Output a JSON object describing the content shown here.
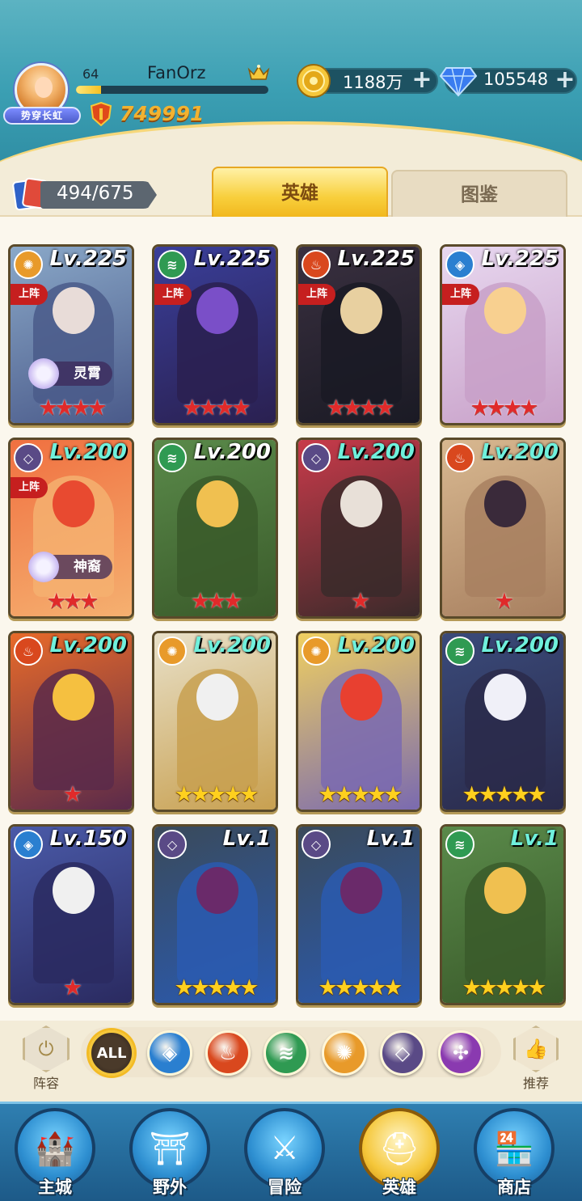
{
  "player": {
    "level": "64",
    "name": "FanOrz",
    "title_badge": "势穿长虹",
    "power": "749991",
    "exp_fraction": 0.13
  },
  "resources": {
    "gold": "1188万",
    "gems": "105548"
  },
  "collection": {
    "card_count": "494/675"
  },
  "tabs": [
    {
      "label": "英雄",
      "active": true
    },
    {
      "label": "图鉴",
      "active": false
    }
  ],
  "heroes": [
    {
      "level": "Lv.225",
      "faction": "light",
      "deployed": "上阵",
      "badge": "灵霄",
      "stars": 4,
      "star_color": "red"
    },
    {
      "level": "Lv.225",
      "faction": "nature",
      "deployed": "上阵",
      "badge": "",
      "stars": 4,
      "star_color": "red"
    },
    {
      "level": "Lv.225",
      "faction": "fire",
      "deployed": "上阵",
      "badge": "",
      "stars": 4,
      "star_color": "red"
    },
    {
      "level": "Lv.225",
      "faction": "water",
      "deployed": "上阵",
      "badge": "",
      "stars": 4,
      "star_color": "red"
    },
    {
      "level": "Lv.200",
      "faction": "dark",
      "deployed": "上阵",
      "badge": "神裔",
      "stars": 3,
      "star_color": "red"
    },
    {
      "level": "Lv.200",
      "faction": "nature",
      "deployed": "",
      "badge": "",
      "stars": 3,
      "star_color": "red"
    },
    {
      "level": "Lv.200",
      "faction": "dark",
      "deployed": "",
      "badge": "",
      "stars": 1,
      "star_color": "red"
    },
    {
      "level": "Lv.200",
      "faction": "fire",
      "deployed": "",
      "badge": "",
      "stars": 1,
      "star_color": "red"
    },
    {
      "level": "Lv.200",
      "faction": "fire",
      "deployed": "",
      "badge": "",
      "stars": 1,
      "star_color": "red"
    },
    {
      "level": "Lv.200",
      "faction": "light",
      "deployed": "",
      "badge": "",
      "stars": 5,
      "star_color": "gold"
    },
    {
      "level": "Lv.200",
      "faction": "light",
      "deployed": "",
      "badge": "",
      "stars": 5,
      "star_color": "gold"
    },
    {
      "level": "Lv.200",
      "faction": "nature",
      "deployed": "",
      "badge": "",
      "stars": 5,
      "star_color": "gold"
    },
    {
      "level": "Lv.150",
      "faction": "water",
      "deployed": "",
      "badge": "",
      "stars": 1,
      "star_color": "red"
    },
    {
      "level": "Lv.1",
      "faction": "dark",
      "deployed": "",
      "badge": "",
      "stars": 5,
      "star_color": "gold"
    },
    {
      "level": "Lv.1",
      "faction": "dark",
      "deployed": "",
      "badge": "",
      "stars": 5,
      "star_color": "gold"
    },
    {
      "level": "Lv.1",
      "faction": "nature",
      "deployed": "",
      "badge": "",
      "stars": 5,
      "star_color": "gold"
    }
  ],
  "filters": [
    {
      "label": "ALL",
      "icon": "all-icon"
    },
    {
      "label": "",
      "icon": "water-icon"
    },
    {
      "label": "",
      "icon": "fire-icon"
    },
    {
      "label": "",
      "icon": "nature-icon"
    },
    {
      "label": "",
      "icon": "light-icon"
    },
    {
      "label": "",
      "icon": "dark-icon"
    },
    {
      "label": "",
      "icon": "arcane-icon"
    }
  ],
  "side_buttons": {
    "lineup": "阵容",
    "recommend": "推荐"
  },
  "nav": [
    {
      "label": "主城",
      "icon": "castle-icon"
    },
    {
      "label": "野外",
      "icon": "gate-icon"
    },
    {
      "label": "冒险",
      "icon": "sword-icon"
    },
    {
      "label": "英雄",
      "icon": "helmet-icon",
      "active": true
    },
    {
      "label": "商店",
      "icon": "shop-icon"
    }
  ],
  "faction_colors": {
    "light": "#e89a2a",
    "nature": "#2f9a52",
    "fire": "#d9481e",
    "water": "#2a7fd0",
    "dark": "#5a4a86",
    "arcane": "#8a3ab0"
  }
}
